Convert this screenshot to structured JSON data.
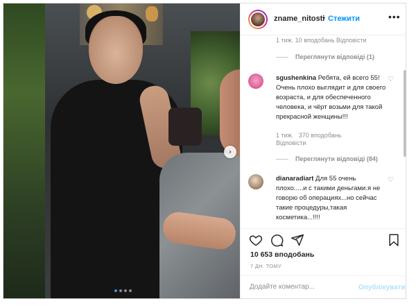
{
  "post": {
    "username": "zname_nitosti",
    "separator": "•",
    "follow_label": "Стежити",
    "more_icon": "more-options-icon",
    "likes": "10 653 вподобань",
    "date": "7 ДН. ТОМУ"
  },
  "comments_panel": {
    "partial_meta": "1 тиж.   10 вподобань   Відповісти",
    "first_replies": "Переглянути відповіді (1)",
    "comments": [
      {
        "username": "sgushenkina",
        "text": "Ребята, ей всего 55! Очень плохо выглядит и для своего возраста, и для обеспеченного человека, и чёрт возьми для такой прекрасной женщины!!!",
        "meta_time": "1 тиж.",
        "meta_likes": "370 вподобань",
        "meta_reply": "Відповісти",
        "replies": "Переглянути відповіді (84)"
      },
      {
        "username": "dianaradiart",
        "text": "Для 55 очень плохо.....и с такими деньгами.я не говорю об операциях...но сейчас такие процедуры,такая косметика...!!!!"
      }
    ]
  },
  "comment_bar": {
    "placeholder": "Додайте коментар...",
    "post_label": "Опублікувати"
  },
  "carousel": {
    "next_icon": "chevron-right-icon",
    "slide_count": 4,
    "active_slide": 1
  },
  "colors": {
    "accent": "#0095f6",
    "post_disabled": "#b2dffc",
    "muted": "#8e8e8e",
    "text": "#262626"
  }
}
